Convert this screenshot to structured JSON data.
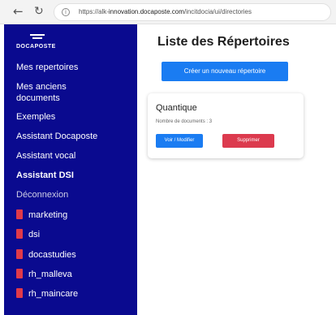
{
  "browser": {
    "back_icon": "arrow-left-icon",
    "reload_icon": "reload-icon",
    "url_prefix": "https://alk-",
    "url_host": "innovation.docaposte.com",
    "url_path": "/incitdocia/ui/directories"
  },
  "sidebar": {
    "logo_text": "DOCAPOSTE",
    "background": "#0a0a8f",
    "menu": [
      {
        "label": "Mes repertoires"
      },
      {
        "label": "Mes anciens"
      },
      {
        "label": "documents"
      },
      {
        "label": "Exemples"
      },
      {
        "label": "Assistant Docaposte"
      },
      {
        "label": "Assistant vocal"
      },
      {
        "label": "Assistant DSI"
      },
      {
        "label": "Déconnexion"
      }
    ],
    "folders": [
      {
        "label": "marketing"
      },
      {
        "label": "dsi"
      },
      {
        "label": "docastudies"
      },
      {
        "label": "rh_malleva"
      },
      {
        "label": "rh_maincare"
      }
    ],
    "folder_color": "#e03a4a"
  },
  "main": {
    "title": "Liste des Répertoires",
    "create_button": "Créer un nouveau répertoire",
    "accent": "#1a7cf2"
  },
  "cards": [
    {
      "name": "Quantique",
      "count_text": "Nombre de documents : 3",
      "view_label": "Voir / Modifier",
      "delete_label": "Supprimer"
    }
  ]
}
